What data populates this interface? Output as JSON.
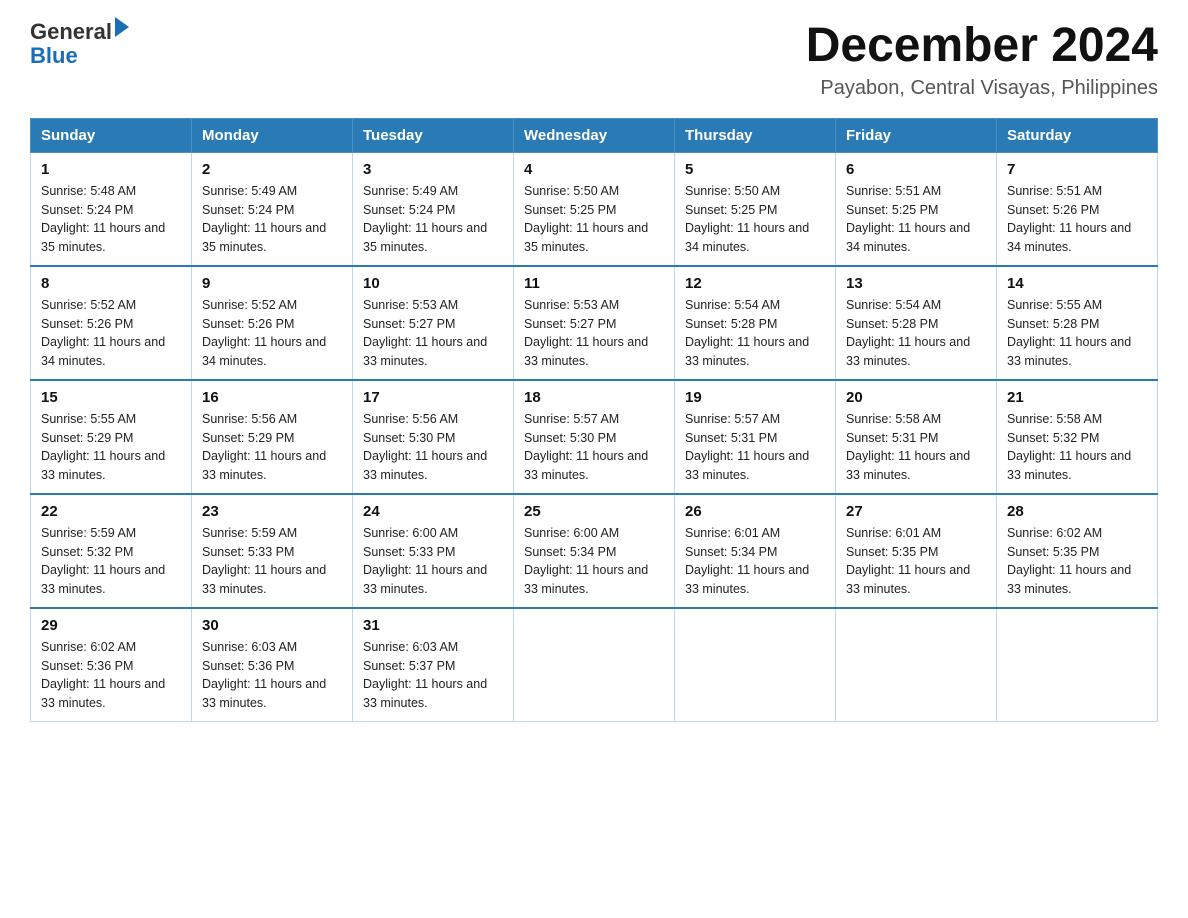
{
  "header": {
    "logo_general": "General",
    "logo_blue": "Blue",
    "title": "December 2024",
    "subtitle": "Payabon, Central Visayas, Philippines"
  },
  "days_of_week": [
    "Sunday",
    "Monday",
    "Tuesday",
    "Wednesday",
    "Thursday",
    "Friday",
    "Saturday"
  ],
  "weeks": [
    [
      {
        "date": "1",
        "sunrise": "Sunrise: 5:48 AM",
        "sunset": "Sunset: 5:24 PM",
        "daylight": "Daylight: 11 hours and 35 minutes."
      },
      {
        "date": "2",
        "sunrise": "Sunrise: 5:49 AM",
        "sunset": "Sunset: 5:24 PM",
        "daylight": "Daylight: 11 hours and 35 minutes."
      },
      {
        "date": "3",
        "sunrise": "Sunrise: 5:49 AM",
        "sunset": "Sunset: 5:24 PM",
        "daylight": "Daylight: 11 hours and 35 minutes."
      },
      {
        "date": "4",
        "sunrise": "Sunrise: 5:50 AM",
        "sunset": "Sunset: 5:25 PM",
        "daylight": "Daylight: 11 hours and 35 minutes."
      },
      {
        "date": "5",
        "sunrise": "Sunrise: 5:50 AM",
        "sunset": "Sunset: 5:25 PM",
        "daylight": "Daylight: 11 hours and 34 minutes."
      },
      {
        "date": "6",
        "sunrise": "Sunrise: 5:51 AM",
        "sunset": "Sunset: 5:25 PM",
        "daylight": "Daylight: 11 hours and 34 minutes."
      },
      {
        "date": "7",
        "sunrise": "Sunrise: 5:51 AM",
        "sunset": "Sunset: 5:26 PM",
        "daylight": "Daylight: 11 hours and 34 minutes."
      }
    ],
    [
      {
        "date": "8",
        "sunrise": "Sunrise: 5:52 AM",
        "sunset": "Sunset: 5:26 PM",
        "daylight": "Daylight: 11 hours and 34 minutes."
      },
      {
        "date": "9",
        "sunrise": "Sunrise: 5:52 AM",
        "sunset": "Sunset: 5:26 PM",
        "daylight": "Daylight: 11 hours and 34 minutes."
      },
      {
        "date": "10",
        "sunrise": "Sunrise: 5:53 AM",
        "sunset": "Sunset: 5:27 PM",
        "daylight": "Daylight: 11 hours and 33 minutes."
      },
      {
        "date": "11",
        "sunrise": "Sunrise: 5:53 AM",
        "sunset": "Sunset: 5:27 PM",
        "daylight": "Daylight: 11 hours and 33 minutes."
      },
      {
        "date": "12",
        "sunrise": "Sunrise: 5:54 AM",
        "sunset": "Sunset: 5:28 PM",
        "daylight": "Daylight: 11 hours and 33 minutes."
      },
      {
        "date": "13",
        "sunrise": "Sunrise: 5:54 AM",
        "sunset": "Sunset: 5:28 PM",
        "daylight": "Daylight: 11 hours and 33 minutes."
      },
      {
        "date": "14",
        "sunrise": "Sunrise: 5:55 AM",
        "sunset": "Sunset: 5:28 PM",
        "daylight": "Daylight: 11 hours and 33 minutes."
      }
    ],
    [
      {
        "date": "15",
        "sunrise": "Sunrise: 5:55 AM",
        "sunset": "Sunset: 5:29 PM",
        "daylight": "Daylight: 11 hours and 33 minutes."
      },
      {
        "date": "16",
        "sunrise": "Sunrise: 5:56 AM",
        "sunset": "Sunset: 5:29 PM",
        "daylight": "Daylight: 11 hours and 33 minutes."
      },
      {
        "date": "17",
        "sunrise": "Sunrise: 5:56 AM",
        "sunset": "Sunset: 5:30 PM",
        "daylight": "Daylight: 11 hours and 33 minutes."
      },
      {
        "date": "18",
        "sunrise": "Sunrise: 5:57 AM",
        "sunset": "Sunset: 5:30 PM",
        "daylight": "Daylight: 11 hours and 33 minutes."
      },
      {
        "date": "19",
        "sunrise": "Sunrise: 5:57 AM",
        "sunset": "Sunset: 5:31 PM",
        "daylight": "Daylight: 11 hours and 33 minutes."
      },
      {
        "date": "20",
        "sunrise": "Sunrise: 5:58 AM",
        "sunset": "Sunset: 5:31 PM",
        "daylight": "Daylight: 11 hours and 33 minutes."
      },
      {
        "date": "21",
        "sunrise": "Sunrise: 5:58 AM",
        "sunset": "Sunset: 5:32 PM",
        "daylight": "Daylight: 11 hours and 33 minutes."
      }
    ],
    [
      {
        "date": "22",
        "sunrise": "Sunrise: 5:59 AM",
        "sunset": "Sunset: 5:32 PM",
        "daylight": "Daylight: 11 hours and 33 minutes."
      },
      {
        "date": "23",
        "sunrise": "Sunrise: 5:59 AM",
        "sunset": "Sunset: 5:33 PM",
        "daylight": "Daylight: 11 hours and 33 minutes."
      },
      {
        "date": "24",
        "sunrise": "Sunrise: 6:00 AM",
        "sunset": "Sunset: 5:33 PM",
        "daylight": "Daylight: 11 hours and 33 minutes."
      },
      {
        "date": "25",
        "sunrise": "Sunrise: 6:00 AM",
        "sunset": "Sunset: 5:34 PM",
        "daylight": "Daylight: 11 hours and 33 minutes."
      },
      {
        "date": "26",
        "sunrise": "Sunrise: 6:01 AM",
        "sunset": "Sunset: 5:34 PM",
        "daylight": "Daylight: 11 hours and 33 minutes."
      },
      {
        "date": "27",
        "sunrise": "Sunrise: 6:01 AM",
        "sunset": "Sunset: 5:35 PM",
        "daylight": "Daylight: 11 hours and 33 minutes."
      },
      {
        "date": "28",
        "sunrise": "Sunrise: 6:02 AM",
        "sunset": "Sunset: 5:35 PM",
        "daylight": "Daylight: 11 hours and 33 minutes."
      }
    ],
    [
      {
        "date": "29",
        "sunrise": "Sunrise: 6:02 AM",
        "sunset": "Sunset: 5:36 PM",
        "daylight": "Daylight: 11 hours and 33 minutes."
      },
      {
        "date": "30",
        "sunrise": "Sunrise: 6:03 AM",
        "sunset": "Sunset: 5:36 PM",
        "daylight": "Daylight: 11 hours and 33 minutes."
      },
      {
        "date": "31",
        "sunrise": "Sunrise: 6:03 AM",
        "sunset": "Sunset: 5:37 PM",
        "daylight": "Daylight: 11 hours and 33 minutes."
      },
      null,
      null,
      null,
      null
    ]
  ]
}
